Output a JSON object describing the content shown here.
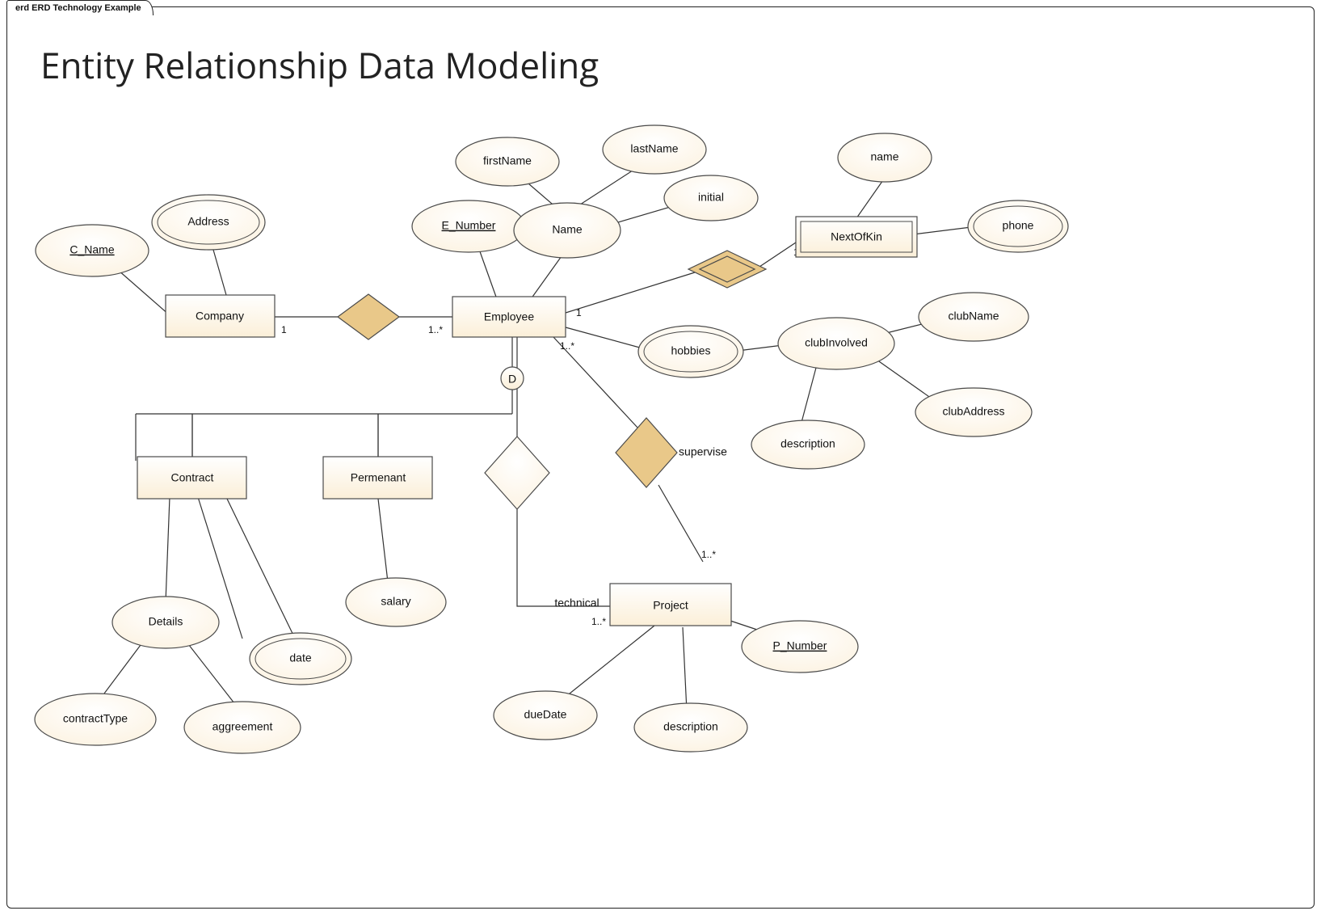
{
  "meta": {
    "tab_label": "erd ERD Technology Example",
    "title": "Entity Relationship Data Modeling"
  },
  "entities": {
    "company": "Company",
    "employee": "Employee",
    "nextofkin": "NextOfKin",
    "contract": "Contract",
    "permanent": "Permenant",
    "project": "Project"
  },
  "attributes": {
    "c_name": "C_Name",
    "address": "Address",
    "e_number": "E_Number",
    "name": "Name",
    "firstname": "firstName",
    "lastname": "lastName",
    "initial": "initial",
    "nok_name": "name",
    "phone": "phone",
    "hobbies": "hobbies",
    "clubinvolved": "clubInvolved",
    "clubname": "clubName",
    "clubaddress": "clubAddress",
    "description_club": "description",
    "details": "Details",
    "contracttype": "contractType",
    "aggreement": "aggreement",
    "date": "date",
    "salary": "salary",
    "duedate": "dueDate",
    "description_proj": "description",
    "p_number": "P_Number"
  },
  "relationships": {
    "company_employee": "",
    "employee_nextofkin": "",
    "technical": "technical",
    "supervise": "supervise"
  },
  "isa_label": "D",
  "cardinalities": {
    "company_side": "1",
    "employee_from_company": "1..*",
    "employee_to_nextofkin": "1",
    "nextofkin_side": "1",
    "employee_to_projects": "1..*",
    "project_supervise": "1..*",
    "project_technical": "1..*"
  }
}
